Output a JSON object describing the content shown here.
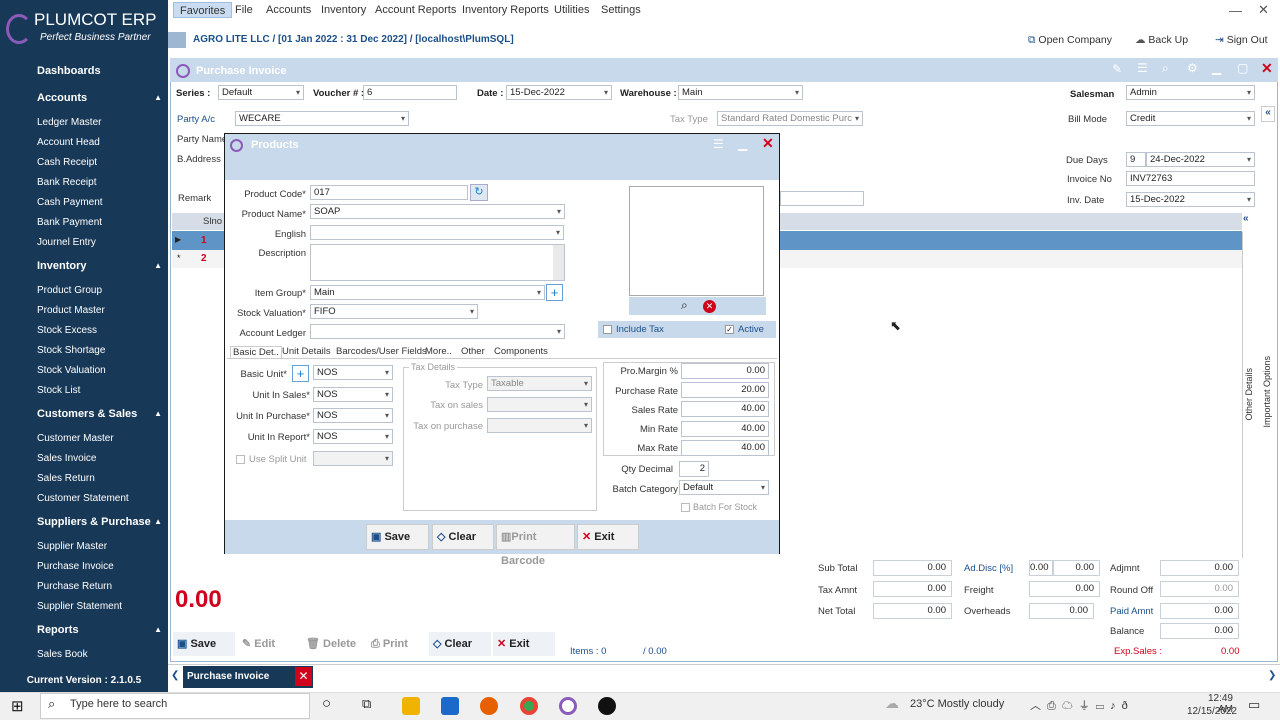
{
  "app": {
    "title": "PLUMCOT ERP",
    "subtitle": "Perfect Business Partner",
    "version": "Current Version : 2.1.0.5"
  },
  "menu": [
    "Favorites",
    "File",
    "Accounts",
    "Inventory",
    "Account Reports",
    "Inventory Reports",
    "Utilities",
    "Settings"
  ],
  "breadcrumb": "AGRO LITE LLC / [01 Jan 2022 : 31 Dec 2022] / [localhost\\PlumSQL]",
  "top_actions": {
    "open_company": "Open Company",
    "backup": "Back Up",
    "sign_out": "Sign Out"
  },
  "sidebar": {
    "dashboards": "Dashboards",
    "sections": [
      {
        "title": "Accounts",
        "items": [
          "Ledger Master",
          "Account Head",
          "Cash Receipt",
          "Bank Receipt",
          "Cash Payment",
          "Bank Payment",
          "Journel Entry"
        ]
      },
      {
        "title": "Inventory",
        "items": [
          "Product Group",
          "Product Master",
          "Stock Excess",
          "Stock Shortage",
          "Stock Valuation",
          "Stock List"
        ]
      },
      {
        "title": "Customers & Sales",
        "items": [
          "Customer Master",
          "Sales Invoice",
          "Sales Return",
          "Customer Statement"
        ]
      },
      {
        "title": "Suppliers & Purchase",
        "items": [
          "Supplier Master",
          "Purchase Invoice",
          "Purchase Return",
          "Supplier Statement"
        ]
      },
      {
        "title": "Reports",
        "items": [
          "Sales Book"
        ]
      }
    ]
  },
  "invoice": {
    "title": "Purchase Invoice",
    "series_label": "Series :",
    "series": "Default",
    "voucher_label": "Voucher # :",
    "voucher": "6",
    "date_label": "Date :",
    "date": "15-Dec-2022",
    "warehouse_label": "Warehouse :",
    "warehouse": "Main",
    "salesman_label": "Salesman",
    "salesman": "Admin",
    "party_label": "Party A/c",
    "party": "WECARE",
    "tax_type_label": "Tax Type",
    "tax_type": "Standard Rated Domestic Purc",
    "bill_mode_label": "Bill Mode",
    "bill_mode": "Credit",
    "party_name_label": "Party Name",
    "address_label": "B.Address",
    "due_days_label": "Due Days",
    "due_days": "9",
    "due_date": "24-Dec-2022",
    "invoice_no_label": "Invoice No",
    "invoice_no": "INV72763",
    "inv_date_label": "Inv. Date",
    "inv_date": "15-Dec-2022",
    "remark_label": "Remark",
    "grid_header": "Slno",
    "rows": [
      "1",
      "2"
    ],
    "big_total": "0.00",
    "totals": {
      "sub_total_label": "Sub Total",
      "sub_total": "0.00",
      "tax_amnt_label": "Tax Amnt",
      "tax_amnt": "0.00",
      "net_total_label": "Net Total",
      "net_total": "0.00",
      "ad_disc_label": "Ad.Disc [%]",
      "ad_disc_pct": "0.00",
      "ad_disc": "0.00",
      "freight_label": "Freight",
      "freight": "0.00",
      "overheads_label": "Overheads",
      "overheads": "0.00",
      "adjmt_label": "Adjmnt",
      "adjmt": "0.00",
      "round_off_label": "Round Off",
      "round_off": "0.00",
      "paid_amnt_label": "Paid Amnt",
      "paid_amnt": "0.00",
      "balance_label": "Balance",
      "balance": "0.00",
      "exp_sales_label": "Exp.Sales :",
      "exp_sales": "0.00"
    },
    "items_label": "Items : 0",
    "items_total": "/ 0.00",
    "buttons": {
      "save": "Save",
      "edit": "Edit",
      "delete": "Delete",
      "print": "Print",
      "clear": "Clear",
      "exit": "Exit"
    },
    "side_tabs": [
      "Other Details",
      "Important Options"
    ]
  },
  "product": {
    "title": "Products",
    "code_label": "Product Code*",
    "code": "017",
    "name_label": "Product Name*",
    "name": "SOAP",
    "english_label": "English",
    "desc_label": "Description",
    "item_group_label": "Item Group*",
    "item_group": "Main",
    "stock_val_label": "Stock Valuation*",
    "stock_val": "FIFO",
    "account_ledger_label": "Account Ledger",
    "include_tax": "Include Tax",
    "active": "Active",
    "tabs": [
      "Basic Det..",
      "Unit Details",
      "Barcodes/User Fields",
      "More..",
      "Other",
      "Components"
    ],
    "basic_unit_label": "Basic Unit*",
    "basic_unit": "NOS",
    "unit_sales_label": "Unit In Sales*",
    "unit_sales": "NOS",
    "unit_purchase_label": "Unit In Purchase*",
    "unit_purchase": "NOS",
    "unit_report_label": "Unit In Report*",
    "unit_report": "NOS",
    "split_unit": "Use Split Unit",
    "tax_details": "Tax Details",
    "tax_type_label": "Tax Type",
    "tax_type": "Taxable",
    "tax_sales_label": "Tax on sales",
    "tax_purchase_label": "Tax on purchase",
    "margin_label": "Pro.Margin %",
    "margin": "0.00",
    "purchase_rate_label": "Purchase Rate",
    "purchase_rate": "20.00",
    "sales_rate_label": "Sales Rate",
    "sales_rate": "40.00",
    "min_rate_label": "Min Rate",
    "min_rate": "40.00",
    "max_rate_label": "Max Rate",
    "max_rate": "40.00",
    "qty_decimal_label": "Qty Decimal",
    "qty_decimal": "2",
    "batch_cat_label": "Batch Category",
    "batch_cat": "Default",
    "batch_stock": "Batch For Stock",
    "buttons": {
      "save": "Save",
      "clear": "Clear",
      "print_barcode": "Print Barcode",
      "exit": "Exit"
    }
  },
  "bottom_tab": "Purchase Invoice",
  "taskbar": {
    "search": "Type here to search",
    "weather": "23°C  Mostly cloudy",
    "time": "12:49 AM",
    "date": "12/15/2022"
  },
  "colors": {
    "sidebar": "#173857",
    "accent": "#c9d9ec",
    "total": "#d0021b"
  }
}
